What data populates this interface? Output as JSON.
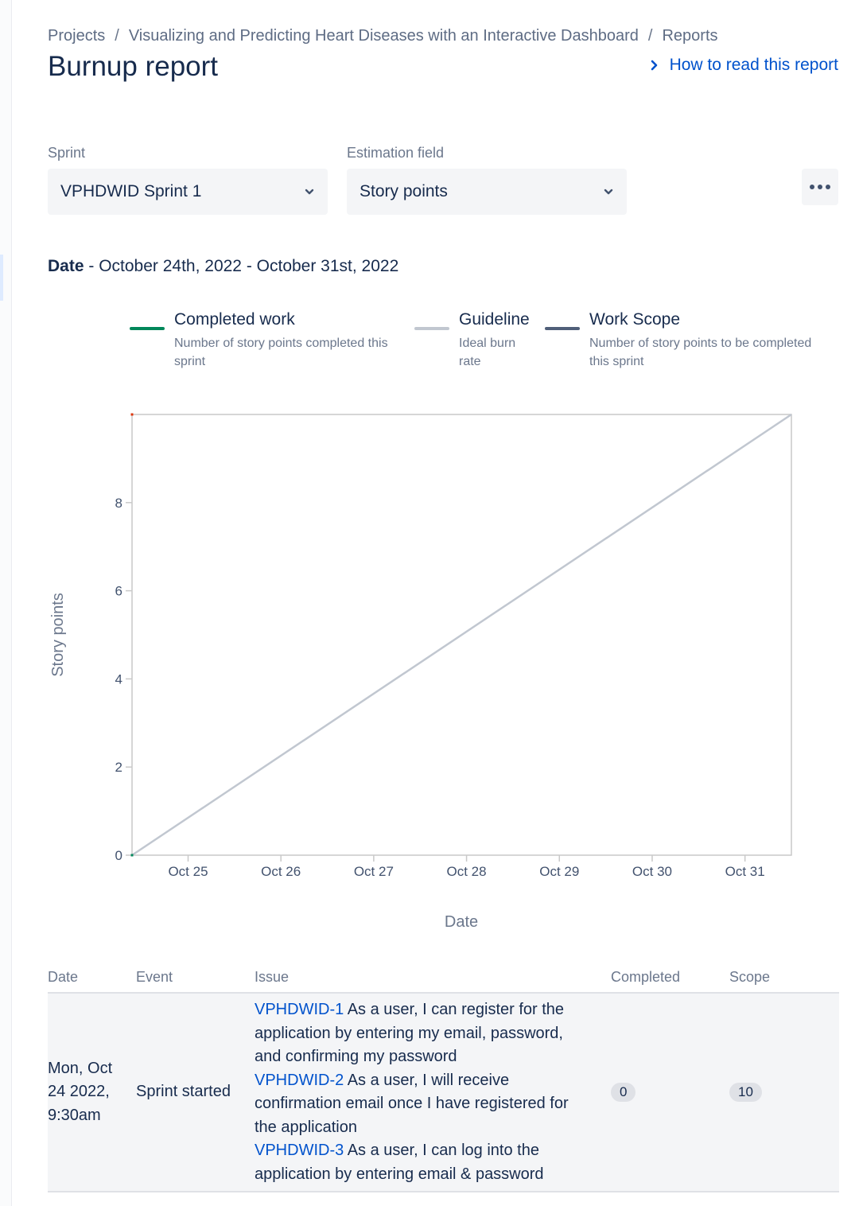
{
  "breadcrumb": {
    "projects": "Projects",
    "project": "Visualizing and Predicting Heart Diseases with an Interactive Dashboard",
    "reports": "Reports",
    "separator": "/"
  },
  "page": {
    "title": "Burnup report",
    "help_link": "How to read this report"
  },
  "filters": {
    "sprint_label": "Sprint",
    "sprint_value": "VPHDWID Sprint 1",
    "estimation_label": "Estimation field",
    "estimation_value": "Story points"
  },
  "date_range": {
    "label": "Date",
    "value": " - October 24th, 2022 - October 31st, 2022"
  },
  "legend": [
    {
      "title": "Completed work",
      "desc": "Number of story points completed this sprint",
      "color": "#00875a"
    },
    {
      "title": "Guideline",
      "desc": "Ideal burn rate",
      "color": "#c1c7d0"
    },
    {
      "title": "Work Scope",
      "desc": "Number of story points to be completed this sprint",
      "color": "#505f79"
    }
  ],
  "chart_data": {
    "type": "line",
    "xlabel": "Date",
    "ylabel": "Story points",
    "x_ticks": [
      "Oct 25",
      "Oct 26",
      "Oct 27",
      "Oct 28",
      "Oct 29",
      "Oct 30",
      "Oct 31"
    ],
    "y_ticks": [
      0,
      2,
      4,
      6,
      8
    ],
    "xlim": [
      "2022-10-24 09:30",
      "2022-10-31 12:00"
    ],
    "ylim": [
      0,
      10
    ],
    "grid": false,
    "series": [
      {
        "name": "Guideline",
        "x": [
          "2022-10-24 09:30",
          "2022-10-31 12:00"
        ],
        "y": [
          0,
          10
        ],
        "color": "#c1c7d0"
      },
      {
        "name": "Completed work",
        "x": [
          "2022-10-24 09:30"
        ],
        "y": [
          0
        ],
        "color": "#00875a"
      },
      {
        "name": "Work Scope",
        "x": [
          "2022-10-24 09:30"
        ],
        "y": [
          10
        ],
        "color": "#de350b"
      }
    ]
  },
  "table": {
    "headers": [
      "Date",
      "Event",
      "Issue",
      "Completed",
      "Scope"
    ],
    "rows": [
      {
        "date": "Mon, Oct 24 2022, 9:30am",
        "event": "Sprint started",
        "issues": [
          {
            "key": "VPHDWID-1",
            "summary": " As a user, I can register for the application by entering my email, password, and confirming my password"
          },
          {
            "key": "VPHDWID-2",
            "summary": " As a user, I will receive confirmation email once I have registered for the application"
          },
          {
            "key": "VPHDWID-3",
            "summary": " As a user, I can log into the application by entering email & password"
          }
        ],
        "completed": "0",
        "scope": "10"
      }
    ]
  }
}
